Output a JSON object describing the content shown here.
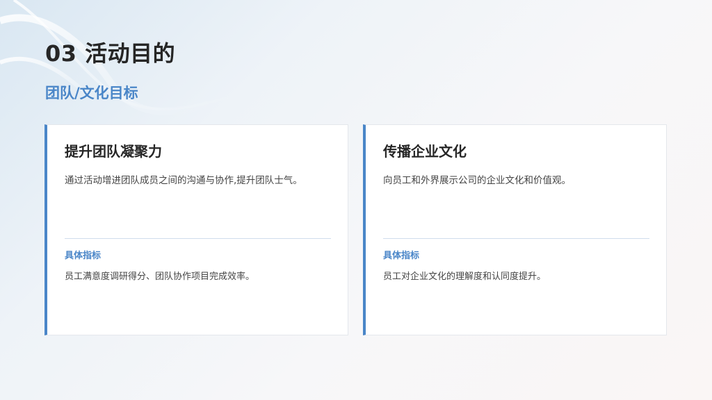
{
  "slide": {
    "title": "03 活动目的",
    "subtitle": "团队/文化目标"
  },
  "cards": [
    {
      "title": "提升团队凝聚力",
      "description": "通过活动增进团队成员之间的沟通与协作,提升团队士气。",
      "metric_label": "具体指标",
      "metric_text": "员工满意度调研得分、团队协作项目完成效率。"
    },
    {
      "title": "传播企业文化",
      "description": "向员工和外界展示公司的企业文化和价值观。",
      "metric_label": "具体指标",
      "metric_text": "员工对企业文化的理解度和认同度提升。"
    }
  ],
  "colors": {
    "accent": "#4a86c8",
    "title": "#262626",
    "body_text": "#444444",
    "card_background": "#ffffff"
  }
}
